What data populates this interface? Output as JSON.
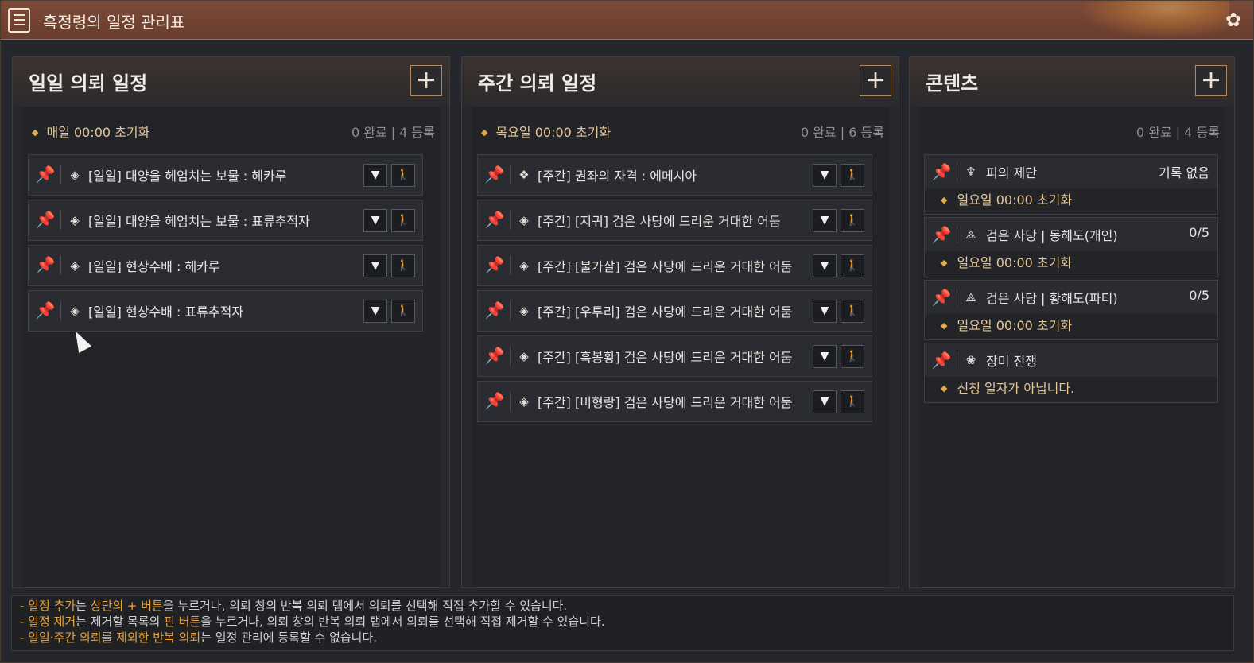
{
  "window": {
    "title": "흑정령의 일정 관리표",
    "menu_icon": "list-icon",
    "close_icon": "flower-close-icon"
  },
  "panels": {
    "daily": {
      "title": "일일 의뢰 일정",
      "add_label": "+",
      "reset": "매일 00:00 초기화",
      "count": "0 완료 | 4 등록",
      "items": [
        {
          "label": "[일일] 대양을 헤엄치는 보물 : 헤카루"
        },
        {
          "label": "[일일] 대양을 헤엄치는 보물 : 표류추적자"
        },
        {
          "label": "[일일] 현상수배 : 헤카루"
        },
        {
          "label": "[일일] 현상수배 : 표류추적자"
        }
      ]
    },
    "weekly": {
      "title": "주간 의뢰 일정",
      "add_label": "+",
      "reset": "목요일 00:00 초기화",
      "count": "0 완료 | 6 등록",
      "items": [
        {
          "label": "[주간] 권좌의 자격 : 에메시아"
        },
        {
          "label": "[주간] [지귀] 검은 사당에 드리운 거대한 어둠"
        },
        {
          "label": "[주간] [불가살] 검은 사당에 드리운 거대한 어둠"
        },
        {
          "label": "[주간] [우투리] 검은 사당에 드리운 거대한 어둠"
        },
        {
          "label": "[주간] [흑봉황] 검은 사당에 드리운 거대한 어둠"
        },
        {
          "label": "[주간] [비형랑] 검은 사당에 드리운 거대한 어둠"
        }
      ]
    },
    "content": {
      "title": "콘텐츠",
      "add_label": "+",
      "count": "0 완료 | 4 등록",
      "items": [
        {
          "label": "피의 제단",
          "value": "기록 없음",
          "sub": "일요일 00:00 초기화"
        },
        {
          "label": "검은 사당 | 동해도(개인)",
          "value": "0/5",
          "sub": "일요일 00:00 초기화"
        },
        {
          "label": "검은 사당 | 황해도(파티)",
          "value": "0/5",
          "sub": "일요일 00:00 초기화"
        },
        {
          "label": "장미 전쟁",
          "value": "",
          "sub": "신청 일자가 아닙니다."
        }
      ]
    }
  },
  "footer": {
    "l1a": "- 일정 추가",
    "l1b": "는 ",
    "l1c": "상단의 + 버튼",
    "l1d": "을 누르거나, 의뢰 창의 반복 의뢰 탭에서 의뢰를 선택해 직접 추가할 수 있습니다.",
    "l2a": "- 일정 제거",
    "l2b": "는 제거할 목록의 ",
    "l2c": "핀 버튼",
    "l2d": "을 누르거나, 의뢰 창의 반복 의뢰 탭에서 의뢰를 선택해 직접 제거할 수 있습니다.",
    "l3a": "- 일일·주간 의뢰를 제외한 반복 의뢰",
    "l3b": "는 일정 관리에 등록할 수 없습니다."
  }
}
